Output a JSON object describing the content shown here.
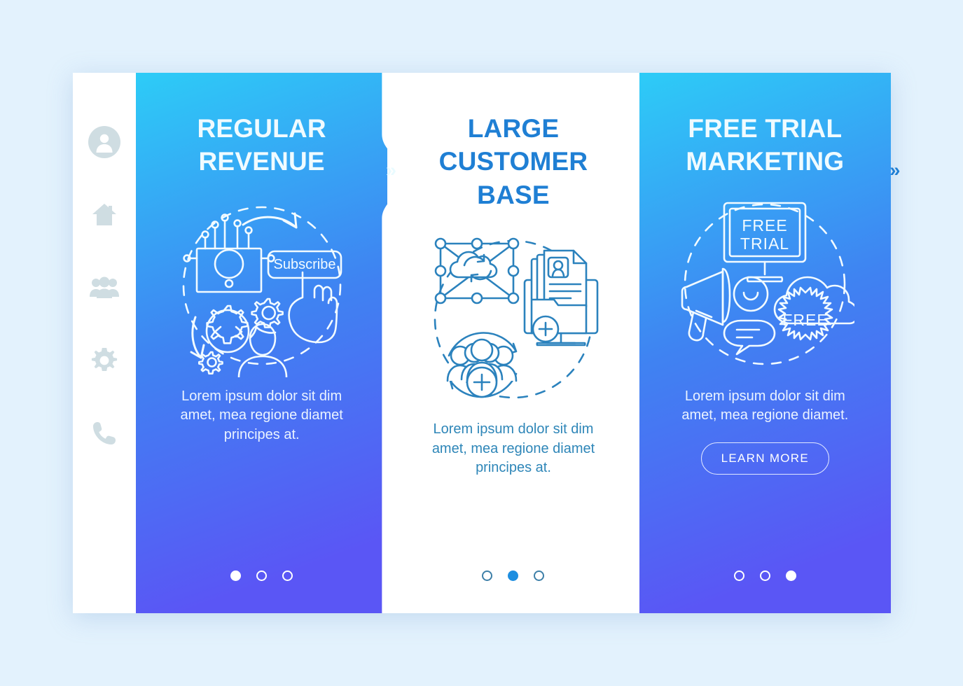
{
  "page": {
    "background_color": "#e3f2fd",
    "card_background": "#ffffff"
  },
  "sidebar": {
    "items": [
      {
        "name": "profile",
        "icon": "user-icon",
        "label": "Profile"
      },
      {
        "name": "home",
        "icon": "home-icon",
        "label": "Home"
      },
      {
        "name": "people",
        "icon": "people-icon",
        "label": "People"
      },
      {
        "name": "settings",
        "icon": "gear-icon",
        "label": "Settings"
      },
      {
        "name": "contact",
        "icon": "phone-icon",
        "label": "Contact"
      }
    ],
    "icon_color": "#cfdde2"
  },
  "separators": {
    "chevron_1": "»",
    "chevron_2": "»"
  },
  "panels": [
    {
      "id": "panel-1",
      "title": "REGULAR REVENUE",
      "body": "Lorem ipsum dolor sit dim amet, mea regione diamet principes at.",
      "style": "gradient",
      "gradient_from": "#2dccf7",
      "gradient_to": "#5a56f5",
      "illustration": {
        "name": "subscribe-revenue-illustration",
        "labels": [
          "Subscribe"
        ],
        "elements": [
          "circuit-board",
          "banknote",
          "subscribe-button",
          "pointing-hand",
          "gears",
          "code-brackets",
          "person",
          "dashed-circle",
          "curved-arrows"
        ]
      },
      "dots": [
        "filled",
        "hollow",
        "hollow"
      ],
      "dot_style": "light",
      "button": null
    },
    {
      "id": "panel-2",
      "title": "LARGE CUSTOMER BASE",
      "body": "Lorem ipsum dolor sit dim amet, mea regione diamet principes at.",
      "style": "white",
      "accent_color": "#1f7fd4",
      "illustration": {
        "name": "customer-base-illustration",
        "labels": [],
        "elements": [
          "network-nodes",
          "cloud-sync",
          "monitor-documents",
          "user-card",
          "group-of-people",
          "plus-badge",
          "circular-arrows",
          "dashed-circle"
        ]
      },
      "dots": [
        "hollow",
        "filled",
        "hollow"
      ],
      "dot_style": "blue",
      "button": null
    },
    {
      "id": "panel-3",
      "title": "FREE TRIAL MARKETING",
      "body": "Lorem ipsum dolor sit dim amet, mea regione diamet.",
      "style": "gradient",
      "gradient_from": "#2dccf7",
      "gradient_to": "#5a56f5",
      "illustration": {
        "name": "free-trial-illustration",
        "labels": [
          "FREE TRIAL",
          "FREE"
        ],
        "elements": [
          "monitor",
          "megaphone",
          "smiley-face",
          "speech-bubble",
          "cloud",
          "starburst-badge",
          "dashed-circle"
        ]
      },
      "dots": [
        "hollow",
        "hollow",
        "filled"
      ],
      "dot_style": "light",
      "button": {
        "label": "LEARN MORE"
      }
    }
  ]
}
